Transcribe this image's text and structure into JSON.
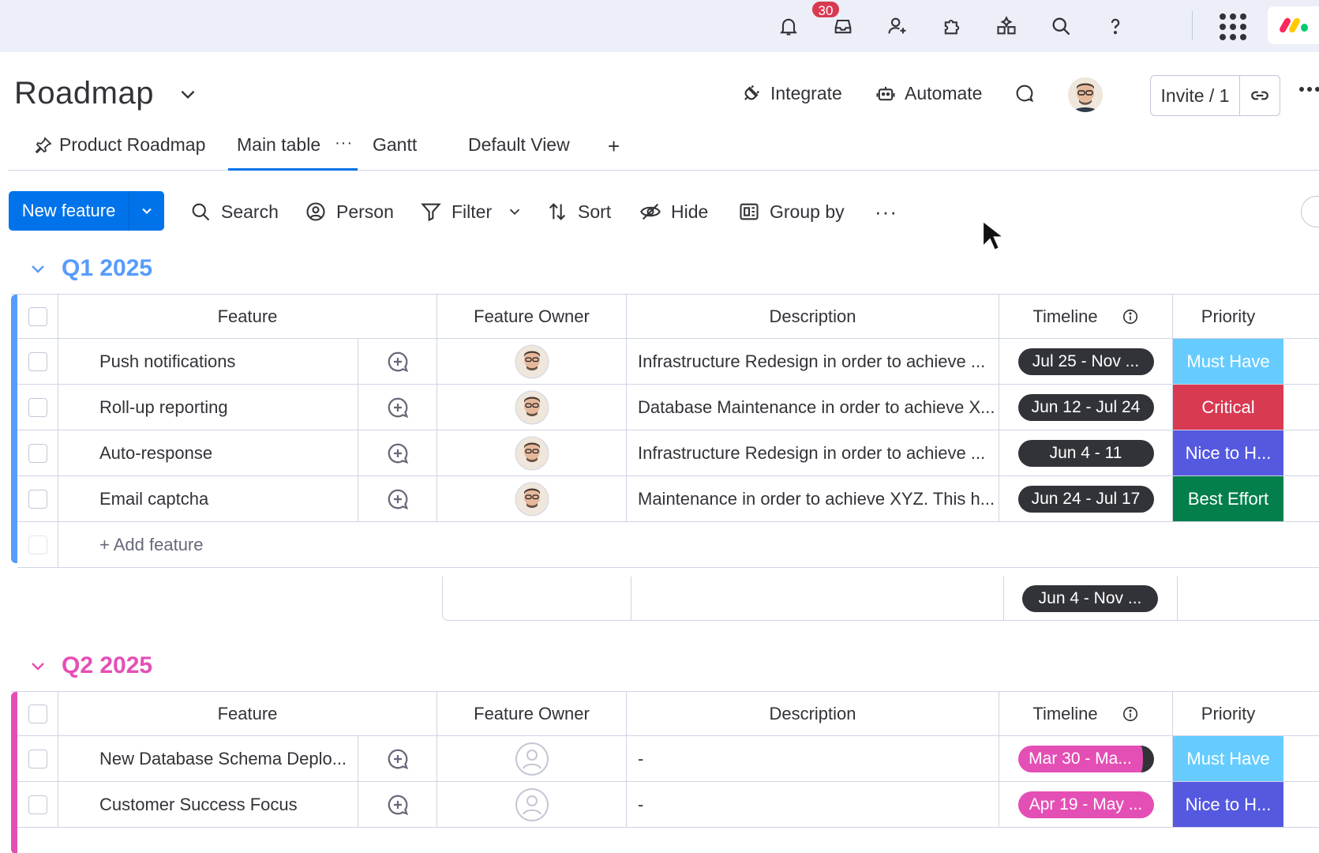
{
  "topbar": {
    "notification_count": "30",
    "icons": [
      "bell-icon",
      "inbox-icon",
      "invite-members-icon",
      "apps-puzzle-icon",
      "sparkle-boxes-icon",
      "search-icon",
      "help-icon",
      "apps-grid-icon"
    ]
  },
  "header": {
    "board_title": "Roadmap",
    "integrate_label": "Integrate",
    "automate_label": "Automate",
    "invite_label": "Invite / 1"
  },
  "tabs": [
    {
      "label": "Product Roadmap"
    },
    {
      "label": "Main table"
    },
    {
      "label": "Gantt"
    },
    {
      "label": "Default View"
    },
    {
      "label": "+"
    }
  ],
  "toolbar": {
    "new_item_label": "New feature",
    "search_label": "Search",
    "person_label": "Person",
    "filter_label": "Filter",
    "sort_label": "Sort",
    "hide_label": "Hide",
    "group_by_label": "Group by"
  },
  "columns": {
    "feature": "Feature",
    "owner": "Feature Owner",
    "description": "Description",
    "timeline": "Timeline",
    "priority": "Priority"
  },
  "colors": {
    "accent_blue": "#0073ea",
    "group1": "#579bfc",
    "group2": "#e44fb5",
    "must_have": "#66ccff",
    "critical": "#d83a52",
    "nice_to_have": "#5559df",
    "best_effort": "#037f4c"
  },
  "groups": [
    {
      "title": "Q1 2025",
      "rows": [
        {
          "feature": "Push notifications",
          "description": "Infrastructure Redesign in order to achieve ...",
          "timeline": "Jul 25 - Nov ...",
          "priority": "Must Have",
          "priority_color": "#66ccff"
        },
        {
          "feature": "Roll-up reporting",
          "description": "Database Maintenance in order to achieve X...",
          "timeline": "Jun 12 - Jul 24",
          "priority": "Critical",
          "priority_color": "#d83a52"
        },
        {
          "feature": "Auto-response",
          "description": "Infrastructure Redesign in order to achieve ...",
          "timeline": "Jun 4 - 11",
          "priority": "Nice to H...",
          "priority_color": "#5559df"
        },
        {
          "feature": "Email captcha",
          "description": "Maintenance in order to achieve XYZ. This h...",
          "timeline": "Jun 24 - Jul 17",
          "priority": "Best Effort",
          "priority_color": "#037f4c"
        }
      ],
      "add_label": "+ Add feature",
      "summary_timeline": "Jun 4 - Nov ..."
    },
    {
      "title": "Q2 2025",
      "rows": [
        {
          "feature": "New Database Schema Deplo...",
          "description": "-",
          "timeline": "Mar 30 - Ma...",
          "priority": "Must Have",
          "priority_color": "#66ccff"
        },
        {
          "feature": "Customer Success Focus",
          "description": "-",
          "timeline": "Apr 19 - May ...",
          "priority": "Nice to H...",
          "priority_color": "#5559df"
        }
      ]
    }
  ]
}
